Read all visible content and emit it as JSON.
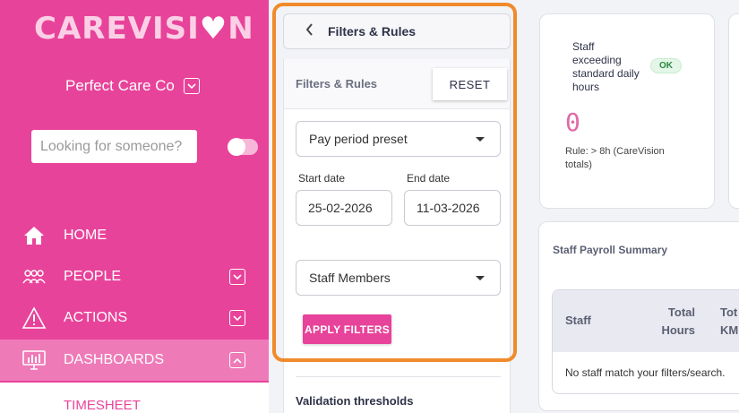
{
  "brand": {
    "logo_text": "CAREVISI",
    "logo_tail": "N"
  },
  "org": {
    "name": "Perfect Care Co"
  },
  "search": {
    "placeholder": "Looking for someone?"
  },
  "nav": {
    "home": "HOME",
    "people": "PEOPLE",
    "actions": "ACTIONS",
    "dashboards": "DASHBOARDS",
    "timesheet": "TIMESHEET"
  },
  "panel": {
    "header_title": "Filters & Rules",
    "section_title": "Filters & Rules",
    "reset_label": "RESET",
    "pay_period": "Pay period preset",
    "start_label": "Start date",
    "end_label": "End date",
    "start_value": "25-02-2026",
    "end_value": "11-03-2026",
    "staff_select": "Staff Members",
    "apply_label": "APPLY FILTERS",
    "validation_title": "Validation thresholds"
  },
  "kpi": {
    "title": "Staff exceeding standard daily hours",
    "badge": "OK",
    "value": "0",
    "rule": "Rule: > 8h (CareVision totals)"
  },
  "summary": {
    "title": "Staff Payroll Summary",
    "columns": [
      "Staff",
      "Total Hours",
      "Tot KM"
    ],
    "empty": "No staff match your filters/search."
  },
  "colors": {
    "brand": "#e8439a",
    "highlight": "#f08a2c"
  }
}
